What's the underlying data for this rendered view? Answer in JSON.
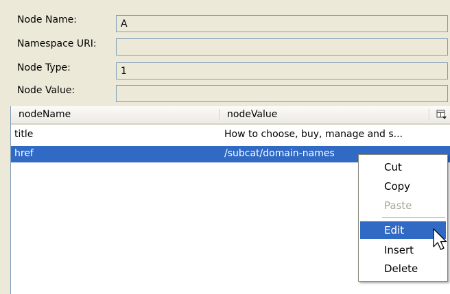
{
  "form": {
    "node_name_label": "Node Name:",
    "node_name_value": "A",
    "namespace_uri_label": "Namespace URI:",
    "namespace_uri_value": "",
    "node_type_label": "Node Type:",
    "node_type_value": "1",
    "node_value_label": "Node Value:",
    "node_value_value": ""
  },
  "table": {
    "columns": [
      "nodeName",
      "nodeValue"
    ],
    "column_chooser_icon": "column-chooser-icon",
    "rows": [
      {
        "name": "title",
        "value": "How to choose, buy, manage and s...",
        "selected": false
      },
      {
        "name": "href",
        "value": "/subcat/domain-names",
        "selected": true
      }
    ]
  },
  "context_menu": {
    "items": [
      {
        "label": "Cut",
        "enabled": true
      },
      {
        "label": "Copy",
        "enabled": true
      },
      {
        "label": "Paste",
        "enabled": false
      },
      {
        "label": "Edit",
        "enabled": true,
        "highlighted": true
      },
      {
        "label": "Insert",
        "enabled": true
      },
      {
        "label": "Delete",
        "enabled": true
      }
    ]
  },
  "colors": {
    "window_bg": "#ece9d8",
    "selection": "#316ac5",
    "field_border": "#7f9db9",
    "disabled_text": "#a8a595"
  }
}
